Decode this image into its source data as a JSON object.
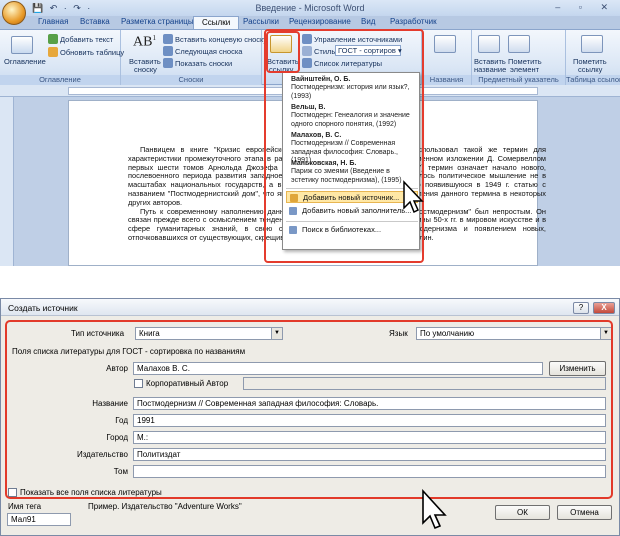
{
  "word": {
    "title": "Введение - Microsoft Word",
    "tabs": [
      "Главная",
      "Вставка",
      "Разметка страницы",
      "Ссылки",
      "Рассылки",
      "Рецензирование",
      "Вид",
      "Разработчик"
    ],
    "active_tab": "Ссылки",
    "ribbon": {
      "toc": {
        "big": "Оглавление",
        "add_text": "Добавить текст",
        "update_table": "Обновить таблицу",
        "group": "Оглавление"
      },
      "footnotes": {
        "big_line1": "Вставить",
        "big_line2": "сноску",
        "insert_endnote": "Вставить концевую сноску",
        "next_footnote": "Следующая сноска",
        "show_notes": "Показать сноски",
        "group": "Сноски"
      },
      "citations": {
        "big_line1": "Вставить",
        "big_line2": "ссылку",
        "manage_sources": "Управление источниками",
        "style_label": "Стиль:",
        "style_value": "ГОСТ - сортиров",
        "bibliography": "Список литературы"
      },
      "captions": {
        "big_line1": "Вставить",
        "big_line2": "название",
        "group": "Названия"
      },
      "index": {
        "big_line1": "Пометить",
        "big_line2": "элемент",
        "group": "Предметный указатель"
      },
      "toa": {
        "big_line1": "Пометить",
        "big_line2": "ссылку",
        "group": "Таблица ссылок"
      }
    },
    "dropdown": {
      "sources": [
        {
          "author": "Вайнштейн, О. Б.",
          "line1": "Постмодернизм: история или язык?,",
          "line2": "(1993)"
        },
        {
          "author": "Вельш, В.",
          "line1": "Постмодерн: Генеалогия и значение",
          "line2": "одного спорного понятия, (1992)"
        },
        {
          "author": "Малахов, В. С.",
          "line1": "Постмодернизм // Современная",
          "line2": "западная философия: Словарь., (1991)"
        },
        {
          "author": "Маньковская, Н. Б.",
          "line1": "Париж со змеями (Введение в",
          "line2": "эстетику постмодернизма), (1995)"
        }
      ],
      "add_source": "Добавить новый источник...",
      "add_placeholder": "Добавить новый заполнитель...",
      "search_library": "Поиск в библиотеках..."
    },
    "doc": {
      "p1": "Панвицем в книге \"Кризис европейской культуры\" (1917). Ф. де Онис использовал такой же термин для характеристики промежуточного этапа в развитии модернизма. В кратком одноименном изложении Д. Сомервеллом первых шести томов Арнольда Джозефа Тойнби \"Исследование истории\" (1947) термин означает начало нового, послевоенного периода развития западноевропейской цивилизации, где указывалось политическое мышление не в масштабах национальных государств, а в рамках мирового содружества. Свою появившуюся в 1949 г. статью с названием \"Постмодернистский дом\", что является примером случайного употребления данного термина в некоторых других авторов.",
      "p2": "Путь к современному наполнению данного термина и появлению понятия \"постмодернизм\" был непростым. Он связан прежде всего с осмыслением тенденций, обозначившихся начиная с середины 50-х гг. в мировом искусстве и в сфере гуманитарных знаний, в свою очередь подготовленных кризисом модернизма и появлением новых, отпочковавшихся от существующих, скрещивающихся между собой научных дисциплин."
    }
  },
  "dialog": {
    "title": "Создать источник",
    "source_type_label": "Тип источника",
    "source_type_value": "Книга",
    "language_label": "Язык",
    "language_value": "По умолчанию",
    "section_caption": "Поля списка литературы для ГОСТ - сортировка по названиям",
    "author_label": "Автор",
    "author_value": "Малахов В. С.",
    "edit_button": "Изменить",
    "corporate_label": "Корпоративный Автор",
    "title_label": "Название",
    "title_value": "Постмодернизм // Современная западная философия: Словарь.",
    "year_label": "Год",
    "year_value": "1991",
    "city_label": "Город",
    "city_value": "М.:",
    "publisher_label": "Издательство",
    "publisher_value": "Политиздат",
    "volume_label": "Том",
    "volume_value": "",
    "show_all_label": "Показать все поля списка литературы",
    "tag_label": "Имя тега",
    "tag_value": "Мал91",
    "example": "Пример. Издательство \"Adventure Works\"",
    "ok": "ОК",
    "cancel": "Отмена",
    "help_glyph": "?",
    "close_glyph": "X"
  }
}
